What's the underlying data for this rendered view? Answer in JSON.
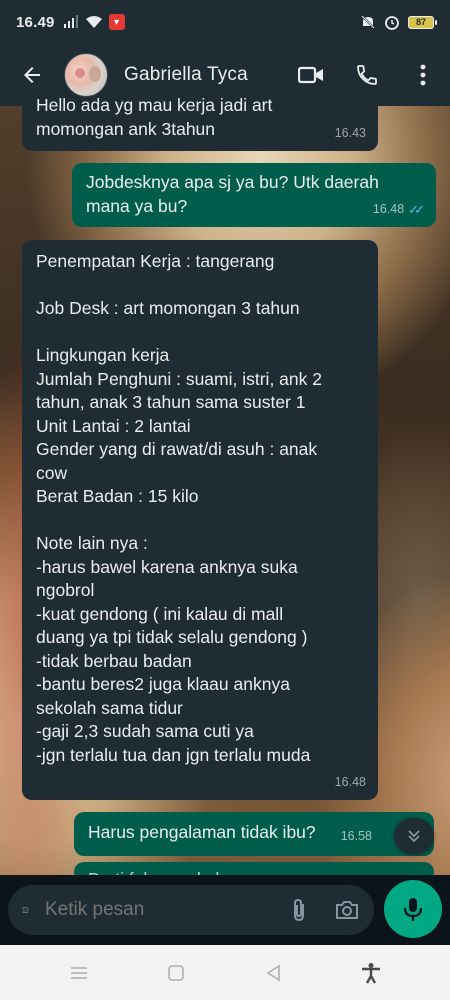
{
  "status_bar": {
    "time": "16.49",
    "battery": "87"
  },
  "header": {
    "contact_name": "Gabriella Tyca"
  },
  "messages": [
    {
      "direction": "incoming",
      "text": "Hello ada yg mau kerja jadi art\nmomongan ank 3tahun",
      "time": "16.43"
    },
    {
      "direction": "outgoing",
      "text": "Jobdesknya apa sj ya bu? Utk daerah\nmana ya bu?",
      "time": "16.48",
      "status": "read"
    },
    {
      "direction": "incoming",
      "text": "Penempatan Kerja : tangerang\n\nJob Desk : art momongan 3 tahun\n\nLingkungan kerja\nJumlah Penghuni : suami, istri, ank 2\ntahun, anak 3 tahun sama suster 1\nUnit Lantai : 2 lantai\nGender yang di rawat/di asuh : anak\ncow\nBerat Badan : 15 kilo\n\nNote lain nya :\n-harus bawel karena anknya suka\nngobrol\n-kuat gendong ( ini kalau di mall\nduang ya tpi tidak selalu gendong )\n-tidak berbau badan\n-bantu beres2 juga klaau anknya\nsekolah sama tidur\n-gaji 2,3 sudah sama cuti ya\n-jgn terlalu tua dan jgn terlalu muda",
      "time": "16.48"
    },
    {
      "direction": "outgoing",
      "text": "Harus pengalaman tidak ibu?",
      "time": "16.58"
    },
    {
      "direction": "outgoing",
      "text": "D   ti f  k        d   h",
      "time": ""
    }
  ],
  "composer": {
    "placeholder": "Ketik pesan"
  },
  "colors": {
    "header": "#1f2c34",
    "incoming_bubble": "#1f2c34",
    "outgoing_bubble": "#005c4b",
    "accent": "#00a884",
    "read_ticks": "#53bdeb"
  },
  "icons": [
    "back-arrow-icon",
    "video-call-icon",
    "phone-icon",
    "more-vert-icon",
    "sticker-icon",
    "attach-icon",
    "camera-icon",
    "mic-icon",
    "scroll-down-icon",
    "menu-icon",
    "home-icon",
    "back-icon",
    "accessibility-icon"
  ]
}
